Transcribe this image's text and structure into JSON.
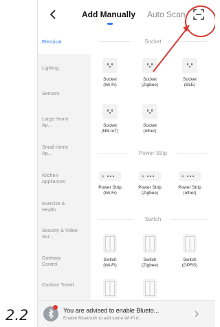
{
  "step_label": "2.2",
  "header": {
    "back_icon": "chevron-left-icon",
    "tab_active": "Add Manually",
    "tab_inactive": "Auto Scan",
    "scan_icon": "scan-frame-icon",
    "accent_color": "#2e7bf0",
    "callout_color": "#d63a32"
  },
  "sidebar": {
    "items": [
      {
        "label": "Electrical",
        "active": true
      },
      {
        "label": "Lighting"
      },
      {
        "label": "Sensors"
      },
      {
        "label": "Large Home Ap..."
      },
      {
        "label": "Small Home Ap..."
      },
      {
        "label": "Kitchen Appliances"
      },
      {
        "label": "Exercise & Health"
      },
      {
        "label": "Security & Video Sur..."
      },
      {
        "label": "Gateway Control"
      },
      {
        "label": "Outdoor Travel"
      }
    ]
  },
  "sections": [
    {
      "title": "Socket",
      "devices": [
        {
          "name": "Socket",
          "sub": "(Wi-Fi)",
          "icon": "socket-icon"
        },
        {
          "name": "Socket",
          "sub": "(Zigbee)",
          "icon": "socket-icon"
        },
        {
          "name": "Socket",
          "sub": "(BLE)",
          "icon": "socket-icon"
        },
        {
          "name": "Socket",
          "sub": "(NB-IoT)",
          "icon": "socket-icon"
        },
        {
          "name": "Socket",
          "sub": "(other)",
          "icon": "socket-icon"
        }
      ]
    },
    {
      "title": "Power Strip",
      "devices": [
        {
          "name": "Power Strip",
          "sub": "(Wi-Fi)",
          "icon": "power-strip-icon"
        },
        {
          "name": "Power Strip",
          "sub": "(Zigbee)",
          "icon": "power-strip-icon"
        },
        {
          "name": "Power Strip",
          "sub": "(other)",
          "icon": "power-strip-icon"
        }
      ]
    },
    {
      "title": "Switch",
      "devices": [
        {
          "name": "Switch",
          "sub": "(Wi-Fi)",
          "icon": "switch-icon"
        },
        {
          "name": "Switch",
          "sub": "(Zigbee)",
          "icon": "switch-icon"
        },
        {
          "name": "Switch",
          "sub": "(GPRS)",
          "icon": "switch-icon"
        }
      ]
    }
  ],
  "banner": {
    "title": "You are advised to enable Blueto...",
    "subtitle": "Enable Bluetooth to add some Wi-Fi d...",
    "icon": "bluetooth-icon"
  }
}
